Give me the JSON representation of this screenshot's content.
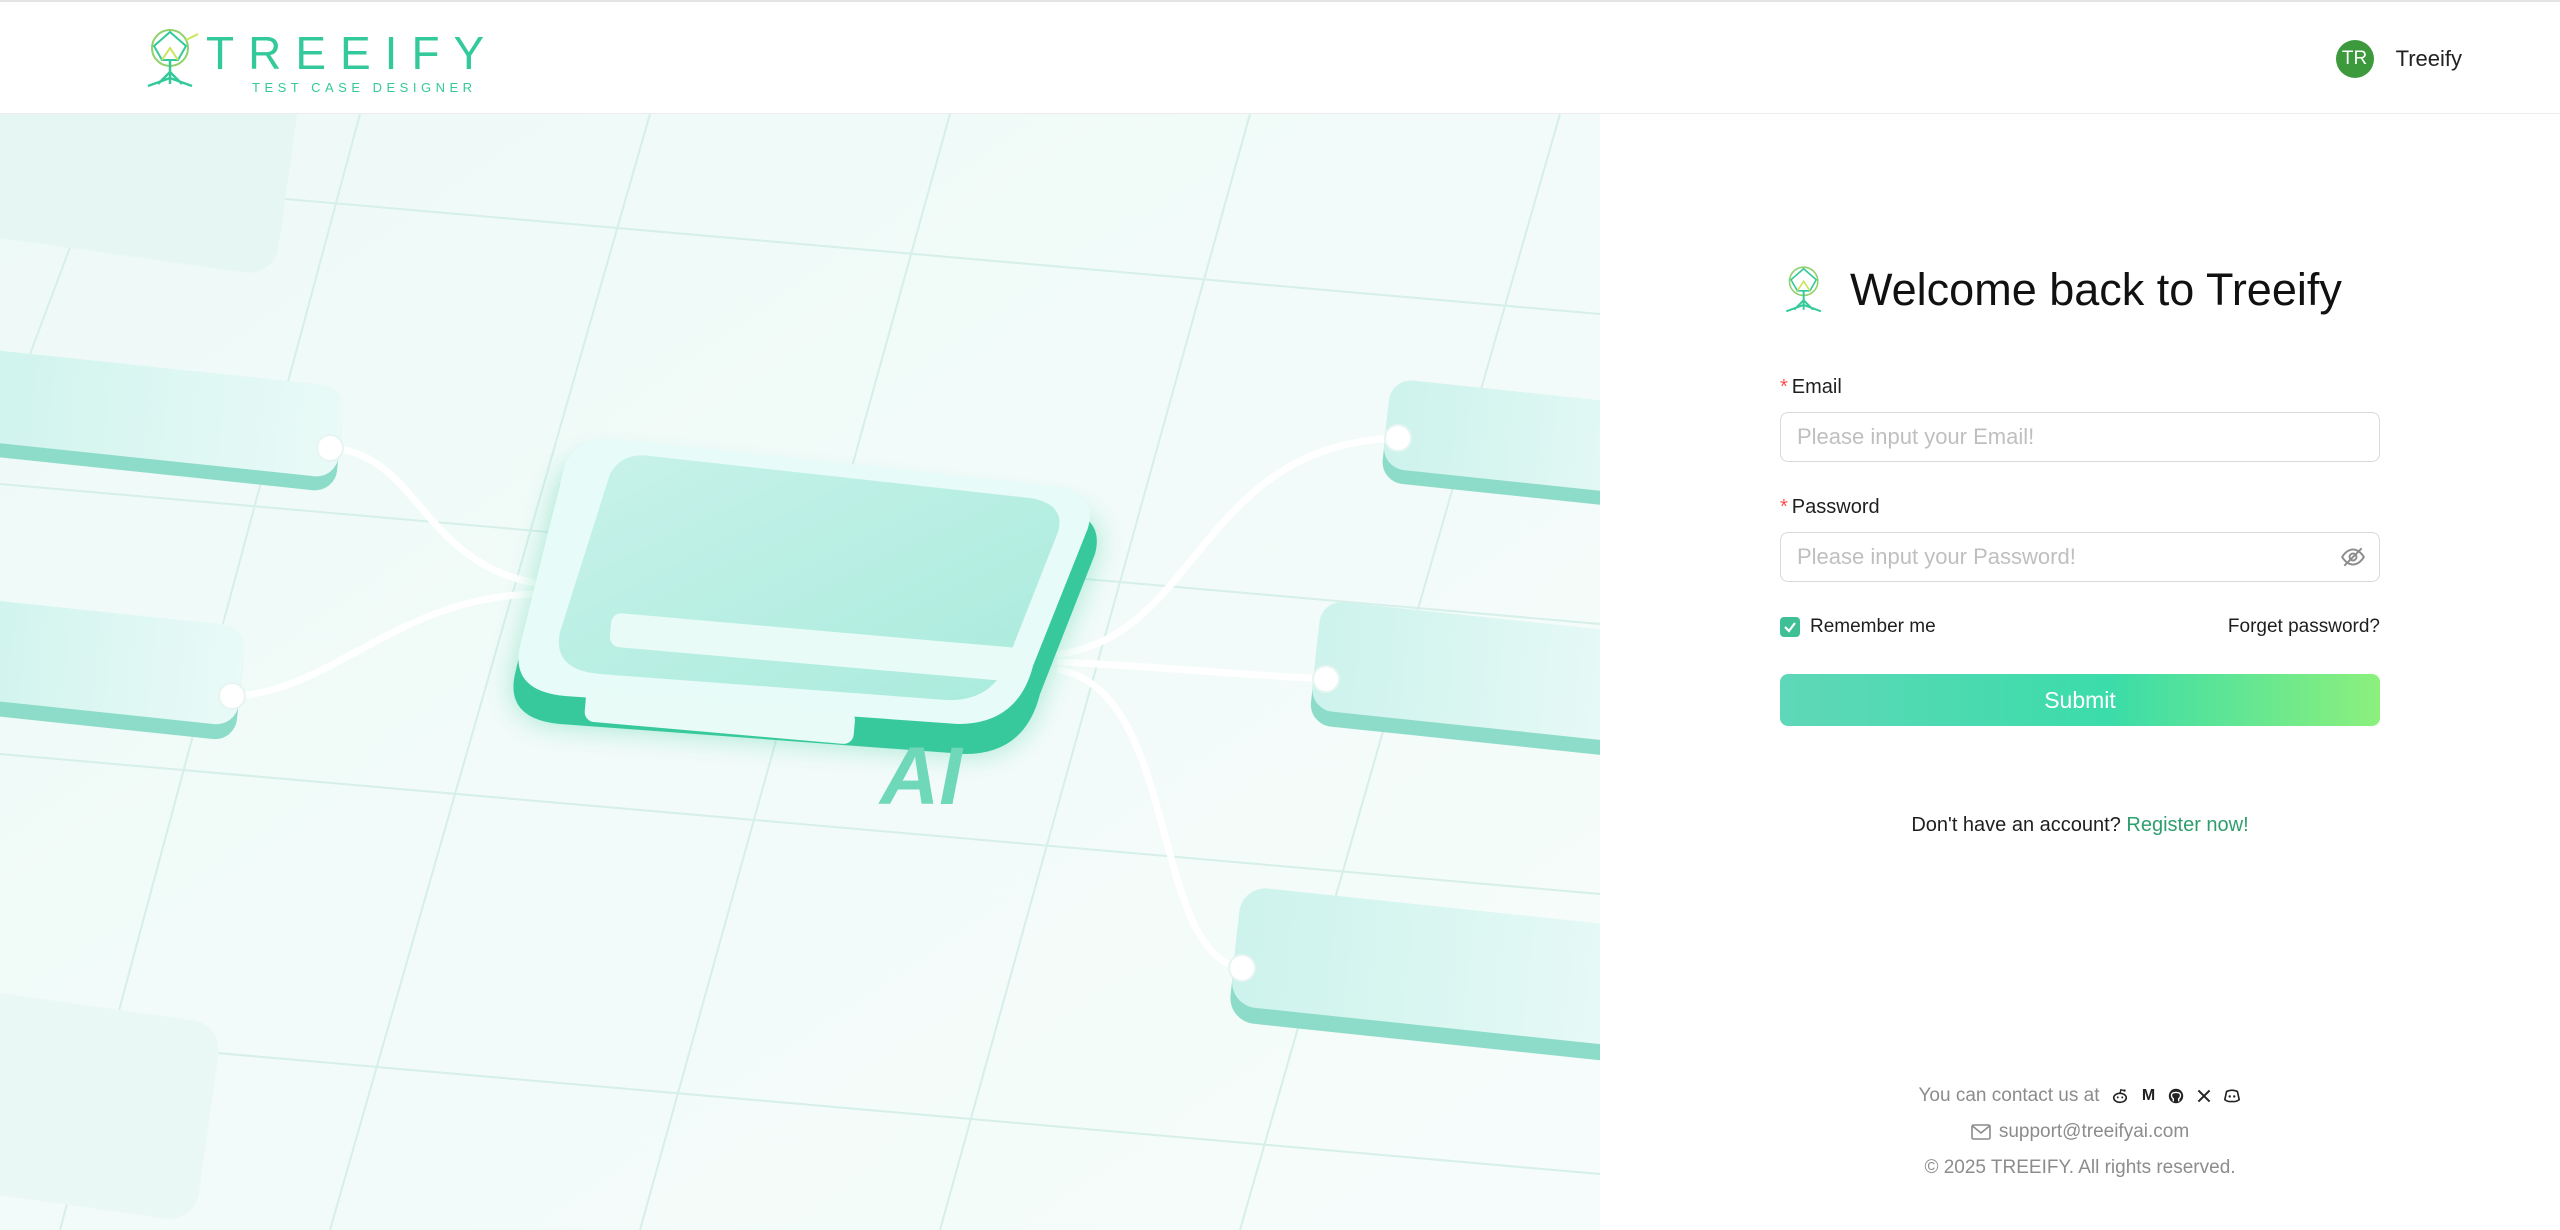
{
  "header": {
    "logo_title": "TREEIFY",
    "logo_subtitle": "TEST CASE DESIGNER",
    "user_initials": "TR",
    "user_name": "Treeify"
  },
  "illustration": {
    "card_text": "AI"
  },
  "login": {
    "title": "Welcome back to Treeify",
    "email_label": "Email",
    "email_placeholder": "Please input your Email!",
    "email_value": "",
    "password_label": "Password",
    "password_placeholder": "Please input your Password!",
    "password_value": "",
    "remember_label": "Remember me",
    "remember_checked": true,
    "forget_label": "Forget password?",
    "submit_label": "Submit",
    "register_prompt": "Don't have an account?",
    "register_link": "Register now!"
  },
  "footer": {
    "contact_text": "You can contact us at",
    "social_icons": [
      "reddit-icon",
      "medium-icon",
      "github-icon",
      "x-icon",
      "discord-icon"
    ],
    "email": "support@treeifyai.com",
    "copyright": "© 2025 TREEIFY. All rights reserved."
  },
  "colors": {
    "accent": "#34c99a",
    "avatar": "#3c9a3c",
    "link": "#2e9e6e",
    "required": "#ff4d4f"
  }
}
